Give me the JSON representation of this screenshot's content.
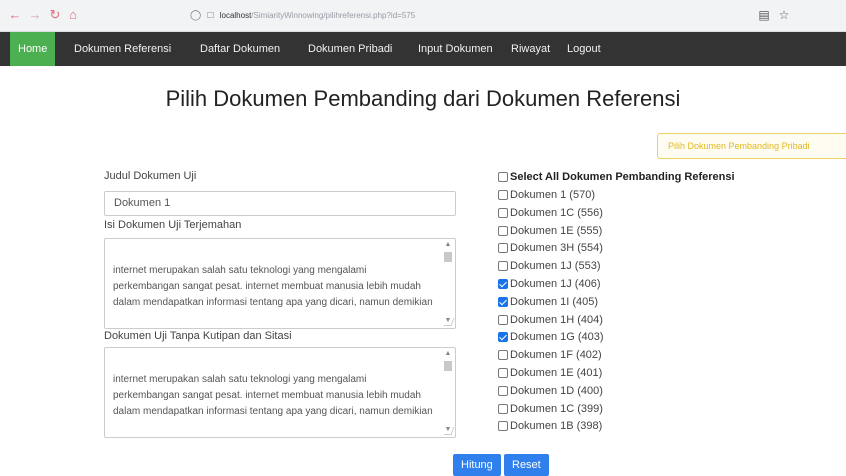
{
  "browser": {
    "url_host": "localhost",
    "url_path": "/SimiarityWinnowing/pilihreferensi.php?id=575"
  },
  "nav": {
    "items": [
      "Home",
      "Dokumen Referensi",
      "Daftar Dokumen",
      "Dokumen Pribadi",
      "Input Dokumen",
      "Riwayat",
      "Logout"
    ],
    "active": "Home",
    "active_color": "#4caf50",
    "bar_color": "#333333"
  },
  "page": {
    "title": "Pilih Dokumen Pembanding dari Dokumen Referensi",
    "pribadi_button": "Pilih Dokumen Pembanding Pribadi"
  },
  "form": {
    "judul_label": "Judul Dokumen Uji",
    "judul_value": "Dokumen 1",
    "isi_label": "Isi Dokumen Uji Terjemahan",
    "isi_text": "internet merupakan salah satu teknologi yang mengalami perkembangan sangat pesat. internet membuat manusia lebih mudah dalam mendapatkan informasi tentang apa yang dicari, namun demikian",
    "tanpa_label": "Dokumen Uji Tanpa Kutipan dan Sitasi",
    "tanpa_text": "internet merupakan salah satu teknologi yang mengalami perkembangan sangat pesat. internet membuat manusia lebih mudah dalam mendapatkan informasi tentang apa yang dicari, namun demikian"
  },
  "checklist": {
    "select_all": "Select All Dokumen Pembanding Referensi",
    "items": [
      {
        "label": "Dokumen 1 (570)",
        "checked": false
      },
      {
        "label": "Dokumen 1C (556)",
        "checked": false
      },
      {
        "label": "Dokumen 1E (555)",
        "checked": false
      },
      {
        "label": "Dokumen 3H (554)",
        "checked": false
      },
      {
        "label": "Dokumen 1J (553)",
        "checked": false
      },
      {
        "label": "Dokumen 1J (406)",
        "checked": true
      },
      {
        "label": "Dokumen 1I (405)",
        "checked": true
      },
      {
        "label": "Dokumen 1H (404)",
        "checked": false
      },
      {
        "label": "Dokumen 1G (403)",
        "checked": true
      },
      {
        "label": "Dokumen 1F (402)",
        "checked": false
      },
      {
        "label": "Dokumen 1E (401)",
        "checked": false
      },
      {
        "label": "Dokumen 1D (400)",
        "checked": false
      },
      {
        "label": "Dokumen 1C (399)",
        "checked": false
      },
      {
        "label": "Dokumen 1B (398)",
        "checked": false
      }
    ]
  },
  "actions": {
    "hitung": "Hitung",
    "reset": "Reset"
  }
}
